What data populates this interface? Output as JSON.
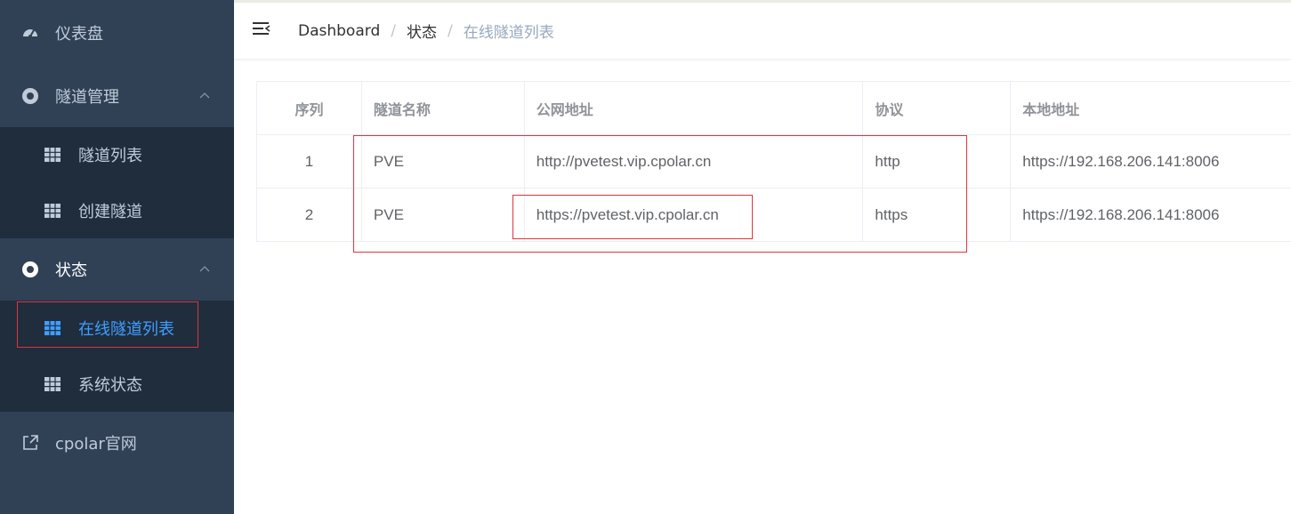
{
  "sidebar": {
    "items": [
      {
        "label": "仪表盘",
        "icon": "dashboard-icon"
      },
      {
        "label": "隧道管理",
        "icon": "compass-icon",
        "expanded": true,
        "children": [
          {
            "label": "隧道列表",
            "icon": "table-icon"
          },
          {
            "label": "创建隧道",
            "icon": "table-icon"
          }
        ]
      },
      {
        "label": "状态",
        "icon": "compass-icon",
        "expanded": true,
        "children": [
          {
            "label": "在线隧道列表",
            "icon": "table-icon",
            "active": true
          },
          {
            "label": "系统状态",
            "icon": "table-icon"
          }
        ]
      },
      {
        "label": "cpolar官网",
        "icon": "external-link-icon"
      }
    ]
  },
  "breadcrumb": [
    "Dashboard",
    "状态",
    "在线隧道列表"
  ],
  "table": {
    "headers": [
      "序列",
      "隧道名称",
      "公网地址",
      "协议",
      "本地地址"
    ],
    "rows": [
      [
        "1",
        "PVE",
        "http://pvetest.vip.cpolar.cn",
        "http",
        "https://192.168.206.141:8006"
      ],
      [
        "2",
        "PVE",
        "https://pvetest.vip.cpolar.cn",
        "https",
        "https://192.168.206.141:8006"
      ]
    ]
  },
  "colors": {
    "sidebar_bg": "#304156",
    "submenu_bg": "#1f2d3d",
    "active": "#409eff",
    "highlight": "#e0343d"
  }
}
